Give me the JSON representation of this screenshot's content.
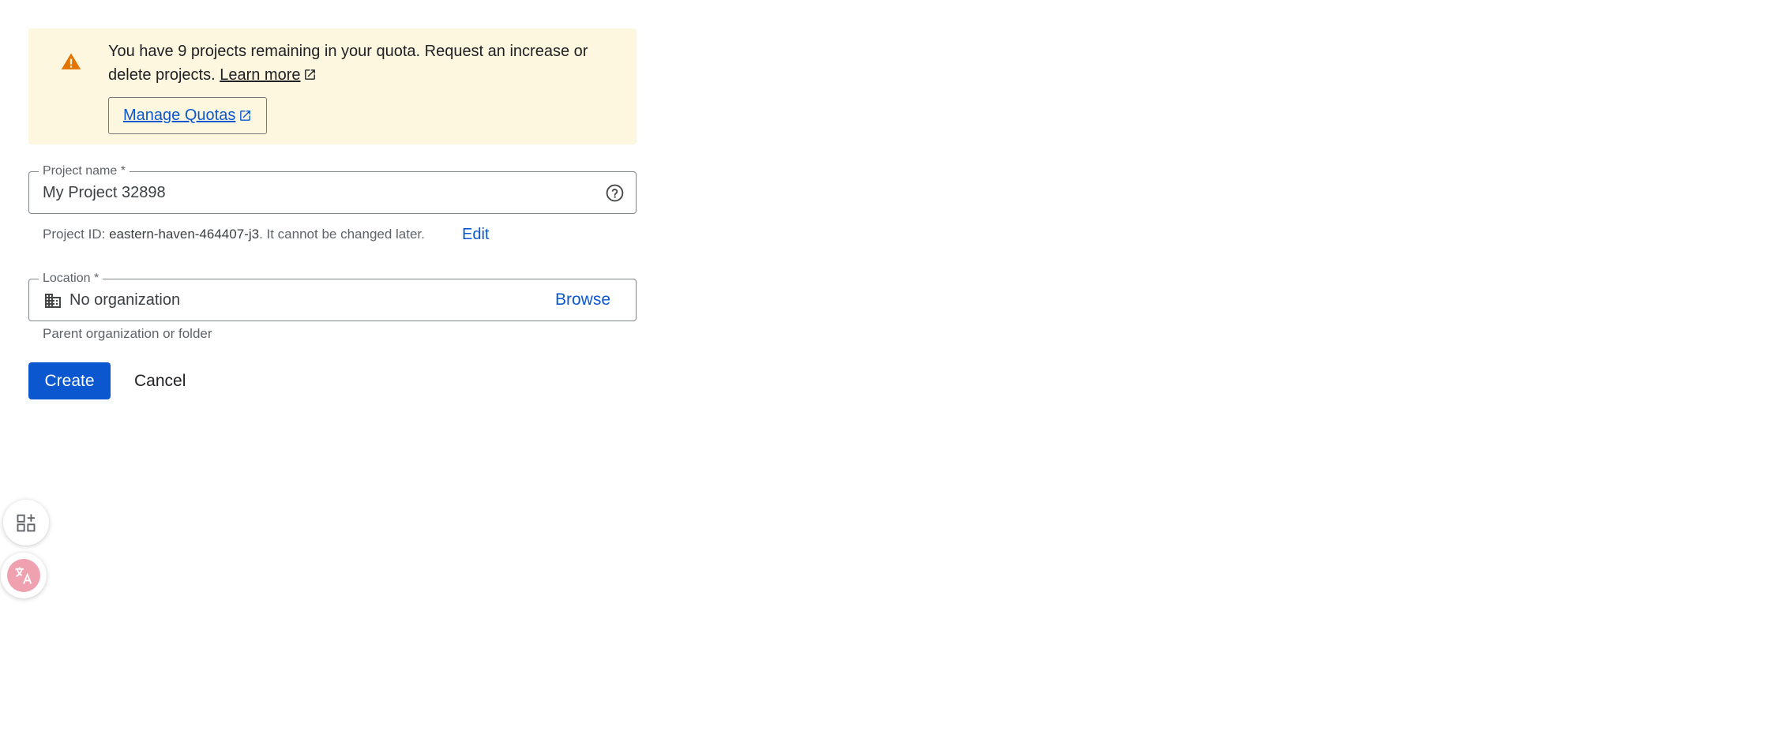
{
  "quota_banner": {
    "message": "You have 9 projects remaining in your quota. Request an increase or delete projects.",
    "learn_more_label": "Learn more",
    "manage_quotas_label": "Manage Quotas",
    "icon": "warning-icon",
    "accent_color": "#e37400",
    "background_color": "#fef7e0"
  },
  "project_name_field": {
    "label": "Project name *",
    "value": "My Project 32898",
    "help_icon": "help-circle-icon"
  },
  "project_id": {
    "prefix": "Project ID:",
    "value": "eastern-haven-464407-j3",
    "suffix": ". It cannot be changed later.",
    "edit_label": "Edit"
  },
  "location_field": {
    "label": "Location *",
    "value": "No organization",
    "icon": "building-icon",
    "browse_label": "Browse",
    "hint": "Parent organization or folder"
  },
  "actions": {
    "create_label": "Create",
    "cancel_label": "Cancel",
    "primary_color": "#0b57d0"
  },
  "floating_widgets": {
    "apps_icon": "apps-add-icon",
    "translate_icon": "translate-icon"
  }
}
